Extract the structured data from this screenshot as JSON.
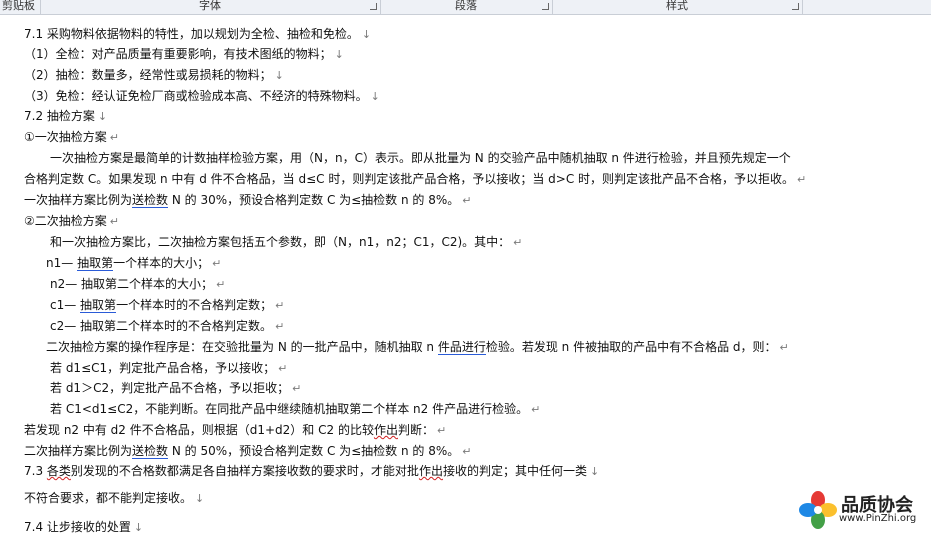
{
  "ribbon": {
    "clipboard": "剪贴板",
    "font": "字体",
    "paragraph": "段落",
    "styles": "样式"
  },
  "doc": {
    "l_sec71": "7.1 采购物料依据物料的特性，加以规划为全检、抽检和免检。",
    "l_full": "（1）全检：对产品质量有重要影响，有技术图纸的物料；",
    "l_sample": "（2）抽检：数量多，经常性或易损耗的物料；",
    "l_exempt": "（3）免检：经认证免检厂商或检验成本高、不经济的特殊物料。",
    "l_sec72": "7.2 抽检方案",
    "l_single_title": "①一次抽检方案",
    "l_single_p1": "一次抽检方案是最简单的计数抽样检验方案，用（N，n，C）表示。即从批量为 N 的交验产品中随机抽取 n 件进行检验，并且预先规定一个",
    "l_single_p2": "合格判定数 C。如果发现 n 中有 d 件不合格品，当 d≤C 时，则判定该批产品合格，予以接收；当 d>C 时，则判定该批产品不合格，予以拒收。",
    "l_single_p3a": "一次抽样方案比例为",
    "l_single_p3u": "送检数",
    "l_single_p3b": " N 的 30%，预设合格判定数 C 为≤抽检数 n 的 8%。",
    "l_double_title": "②二次抽检方案",
    "l_double_p1": "和一次抽检方案比，二次抽检方案包括五个参数，即（N，n1，n2；C1，C2)。其中：",
    "l_n1a": "n1—  ",
    "l_n1u": "抽取第",
    "l_n1b": "一个样本的大小；",
    "l_n2": "n2—  抽取第二个样本的大小；",
    "l_c1a": "c1—  ",
    "l_c1u": "抽取第",
    "l_c1b": "一个样本时的不合格判定数；",
    "l_c2": "c2—  抽取第二个样本时的不合格判定数。",
    "l_proc_a": "二次抽检方案的操作程序是：在交验批量为 N 的一批产品中，随机抽取 n ",
    "l_proc_u": "件品进行",
    "l_proc_b": "检验。若发现 n 件被抽取的产品中有不合格品 d，则：",
    "l_if1": "若 d1≤C1，判定批产品合格，予以接收；",
    "l_if2": "若 d1＞C2，判定批产品不合格，予以拒收；",
    "l_if3": "若 C1<d1≤C2，不能判断。在同批产品中继续随机抽取第二个样本 n2 件产品进行检验。",
    "l_found_a": "若发现 n2 中有 d2 件不合格品，则根据（d1+d2）和 C2 的比较",
    "l_found_u": "作出",
    "l_found_b": "判断：",
    "l_double_ratio_a": "二次抽样方案比例为",
    "l_double_ratio_u": "送检数",
    "l_double_ratio_b": " N 的 50%，预设合格判定数 C 为≤抽检数 n 的 8%。",
    "l_sec73_a": "7.3 ",
    "l_sec73_u1": "各类",
    "l_sec73_b": "别发现的不合格数都满足各自抽样方案接收数的要求时，才能对批",
    "l_sec73_u2": "作出",
    "l_sec73_c": "接收的判定；其中任何一类",
    "l_sec73_cont": "不符合要求，都不能判定接收。",
    "l_sec74": "7.4 让步接收的处置",
    "pilcrow": "↵",
    "arrow": "↓"
  },
  "watermark": {
    "name": "品质协会",
    "url": "www.PinZhi.org"
  },
  "colors": {
    "ribbon_bg": "#eef1f6",
    "link_underline": "#2a5bd7",
    "spell_underline": "#d02020"
  }
}
